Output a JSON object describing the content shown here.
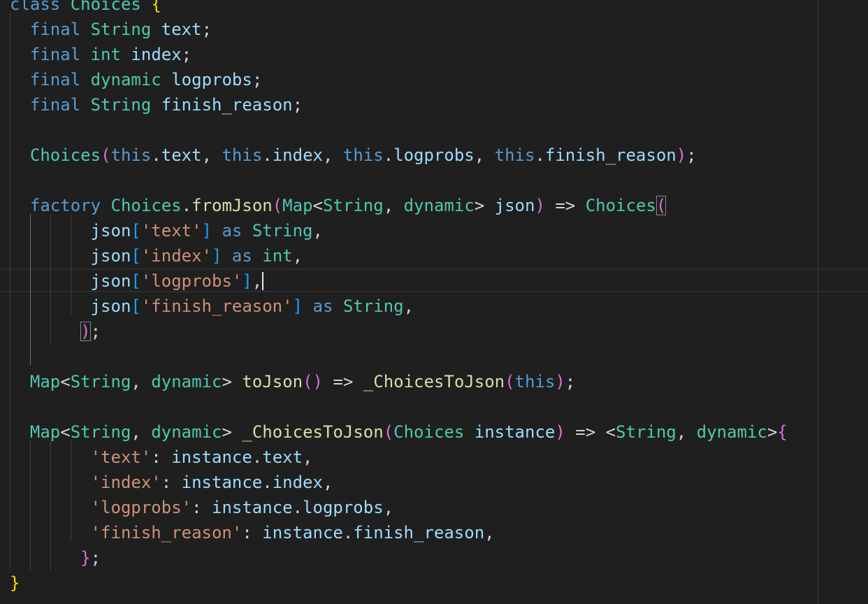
{
  "editor": {
    "language": "dart",
    "theme": "dark",
    "lines": [
      [
        [
          "class",
          "kw"
        ],
        [
          " ",
          "pn"
        ],
        [
          "Choices",
          "ty"
        ],
        [
          " ",
          "pn"
        ],
        [
          "{",
          "b1"
        ]
      ],
      [
        [
          "  ",
          "pn"
        ],
        [
          "final",
          "kw"
        ],
        [
          " ",
          "pn"
        ],
        [
          "String",
          "ty"
        ],
        [
          " ",
          "pn"
        ],
        [
          "text",
          "id"
        ],
        [
          ";",
          "pn"
        ]
      ],
      [
        [
          "  ",
          "pn"
        ],
        [
          "final",
          "kw"
        ],
        [
          " ",
          "pn"
        ],
        [
          "int",
          "ty"
        ],
        [
          " ",
          "pn"
        ],
        [
          "index",
          "id"
        ],
        [
          ";",
          "pn"
        ]
      ],
      [
        [
          "  ",
          "pn"
        ],
        [
          "final",
          "kw"
        ],
        [
          " ",
          "pn"
        ],
        [
          "dynamic",
          "ty"
        ],
        [
          " ",
          "pn"
        ],
        [
          "logprobs",
          "id"
        ],
        [
          ";",
          "pn"
        ]
      ],
      [
        [
          "  ",
          "pn"
        ],
        [
          "final",
          "kw"
        ],
        [
          " ",
          "pn"
        ],
        [
          "String",
          "ty"
        ],
        [
          " ",
          "pn"
        ],
        [
          "finish_reason",
          "id"
        ],
        [
          ";",
          "pn"
        ]
      ],
      [],
      [
        [
          "  ",
          "pn"
        ],
        [
          "Choices",
          "ty"
        ],
        [
          "(",
          "b2"
        ],
        [
          "this",
          "kw"
        ],
        [
          ".",
          "pn"
        ],
        [
          "text",
          "id"
        ],
        [
          ", ",
          "pn"
        ],
        [
          "this",
          "kw"
        ],
        [
          ".",
          "pn"
        ],
        [
          "index",
          "id"
        ],
        [
          ", ",
          "pn"
        ],
        [
          "this",
          "kw"
        ],
        [
          ".",
          "pn"
        ],
        [
          "logprobs",
          "id"
        ],
        [
          ", ",
          "pn"
        ],
        [
          "this",
          "kw"
        ],
        [
          ".",
          "pn"
        ],
        [
          "finish_reason",
          "id"
        ],
        [
          ")",
          "b2"
        ],
        [
          ";",
          "pn"
        ]
      ],
      [],
      [
        [
          "  ",
          "pn"
        ],
        [
          "factory",
          "kw"
        ],
        [
          " ",
          "pn"
        ],
        [
          "Choices",
          "ty"
        ],
        [
          ".",
          "pn"
        ],
        [
          "fromJson",
          "fn"
        ],
        [
          "(",
          "b2"
        ],
        [
          "Map",
          "ty"
        ],
        [
          "<",
          "pn"
        ],
        [
          "String",
          "ty"
        ],
        [
          ", ",
          "pn"
        ],
        [
          "dynamic",
          "ty"
        ],
        [
          "> ",
          "pn"
        ],
        [
          "json",
          "id"
        ],
        [
          ")",
          "b2"
        ],
        [
          " => ",
          "pn"
        ],
        [
          "Choices",
          "ty"
        ],
        [
          "(",
          "b2 match"
        ]
      ],
      [
        [
          "        ",
          "pn"
        ],
        [
          "json",
          "id"
        ],
        [
          "[",
          "b3"
        ],
        [
          "'text'",
          "str"
        ],
        [
          "]",
          "b3"
        ],
        [
          " ",
          "pn"
        ],
        [
          "as",
          "kw"
        ],
        [
          " ",
          "pn"
        ],
        [
          "String",
          "ty"
        ],
        [
          ",",
          "pn"
        ]
      ],
      [
        [
          "        ",
          "pn"
        ],
        [
          "json",
          "id"
        ],
        [
          "[",
          "b3"
        ],
        [
          "'index'",
          "str"
        ],
        [
          "]",
          "b3"
        ],
        [
          " ",
          "pn"
        ],
        [
          "as",
          "kw"
        ],
        [
          " ",
          "pn"
        ],
        [
          "int",
          "ty"
        ],
        [
          ",",
          "pn"
        ]
      ],
      [
        [
          "        ",
          "pn"
        ],
        [
          "json",
          "id"
        ],
        [
          "[",
          "b3"
        ],
        [
          "'logprobs'",
          "str"
        ],
        [
          "]",
          "b3"
        ],
        [
          ",",
          "pn"
        ],
        [
          "",
          "cursor"
        ]
      ],
      [
        [
          "        ",
          "pn"
        ],
        [
          "json",
          "id"
        ],
        [
          "[",
          "b3"
        ],
        [
          "'finish_reason'",
          "str"
        ],
        [
          "]",
          "b3"
        ],
        [
          " ",
          "pn"
        ],
        [
          "as",
          "kw"
        ],
        [
          " ",
          "pn"
        ],
        [
          "String",
          "ty"
        ],
        [
          ",",
          "pn"
        ]
      ],
      [
        [
          "       ",
          "pn"
        ],
        [
          ")",
          "b2 match"
        ],
        [
          ";",
          "pn"
        ]
      ],
      [],
      [
        [
          "  ",
          "pn"
        ],
        [
          "Map",
          "ty"
        ],
        [
          "<",
          "pn"
        ],
        [
          "String",
          "ty"
        ],
        [
          ", ",
          "pn"
        ],
        [
          "dynamic",
          "ty"
        ],
        [
          "> ",
          "pn"
        ],
        [
          "toJson",
          "fn"
        ],
        [
          "()",
          "b2"
        ],
        [
          " => ",
          "pn"
        ],
        [
          "_ChoicesToJson",
          "fn"
        ],
        [
          "(",
          "b2"
        ],
        [
          "this",
          "kw"
        ],
        [
          ")",
          "b2"
        ],
        [
          ";",
          "pn"
        ]
      ],
      [],
      [
        [
          "  ",
          "pn"
        ],
        [
          "Map",
          "ty"
        ],
        [
          "<",
          "pn"
        ],
        [
          "String",
          "ty"
        ],
        [
          ", ",
          "pn"
        ],
        [
          "dynamic",
          "ty"
        ],
        [
          "> ",
          "pn"
        ],
        [
          "_ChoicesToJson",
          "fn"
        ],
        [
          "(",
          "b2"
        ],
        [
          "Choices",
          "ty"
        ],
        [
          " ",
          "pn"
        ],
        [
          "instance",
          "id"
        ],
        [
          ")",
          "b2"
        ],
        [
          " => <",
          "pn"
        ],
        [
          "String",
          "ty"
        ],
        [
          ", ",
          "pn"
        ],
        [
          "dynamic",
          "ty"
        ],
        [
          ">",
          "pn"
        ],
        [
          "{",
          "b2"
        ]
      ],
      [
        [
          "        ",
          "pn"
        ],
        [
          "'text'",
          "str"
        ],
        [
          ": ",
          "pn"
        ],
        [
          "instance",
          "id"
        ],
        [
          ".",
          "pn"
        ],
        [
          "text",
          "id"
        ],
        [
          ",",
          "pn"
        ]
      ],
      [
        [
          "        ",
          "pn"
        ],
        [
          "'index'",
          "str"
        ],
        [
          ": ",
          "pn"
        ],
        [
          "instance",
          "id"
        ],
        [
          ".",
          "pn"
        ],
        [
          "index",
          "id"
        ],
        [
          ",",
          "pn"
        ]
      ],
      [
        [
          "        ",
          "pn"
        ],
        [
          "'logprobs'",
          "str"
        ],
        [
          ": ",
          "pn"
        ],
        [
          "instance",
          "id"
        ],
        [
          ".",
          "pn"
        ],
        [
          "logprobs",
          "id"
        ],
        [
          ",",
          "pn"
        ]
      ],
      [
        [
          "        ",
          "pn"
        ],
        [
          "'finish_reason'",
          "str"
        ],
        [
          ": ",
          "pn"
        ],
        [
          "instance",
          "id"
        ],
        [
          ".",
          "pn"
        ],
        [
          "finish_reason",
          "id"
        ],
        [
          ",",
          "pn"
        ]
      ],
      [
        [
          "       ",
          "pn"
        ],
        [
          "}",
          "b2"
        ],
        [
          ";",
          "pn"
        ]
      ],
      [
        [
          "}",
          "b1"
        ]
      ]
    ]
  }
}
